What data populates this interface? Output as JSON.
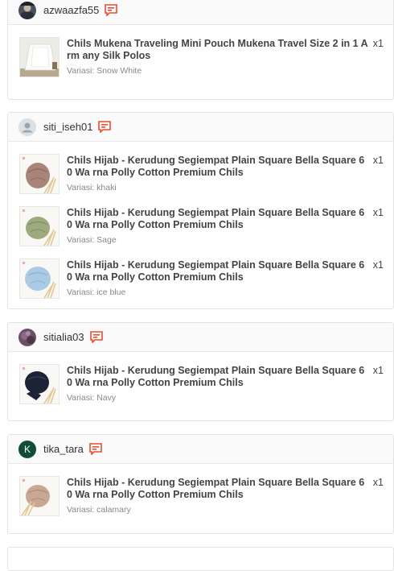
{
  "orders": [
    {
      "username": "azwaazfa55",
      "avatar": "photo-dark",
      "items": [
        {
          "title": "Chils Mukena Traveling Mini Pouch Mukena Travel Size 2 in 1 Arm any Silk Polos",
          "qty": "x1",
          "variant": "Variasi: Snow White",
          "thumb": "mukena-white"
        }
      ]
    },
    {
      "username": "siti_iseh01",
      "avatar": "default-user",
      "items": [
        {
          "title": "Chils Hijab - Kerudung Segiempat Plain Square Bella Square 60 Wa rna Polly Cotton Premium Chils",
          "qty": "x1",
          "variant": "Variasi: khaki",
          "thumb": "hijab-khaki"
        },
        {
          "title": "Chils Hijab - Kerudung Segiempat Plain Square Bella Square 60 Wa rna Polly Cotton Premium Chils",
          "qty": "x1",
          "variant": "Variasi: Sage",
          "thumb": "hijab-sage"
        },
        {
          "title": "Chils Hijab - Kerudung Segiempat Plain Square Bella Square 60 Wa rna Polly Cotton Premium Chils",
          "qty": "x1",
          "variant": "Variasi: ice blue",
          "thumb": "hijab-iceblue"
        }
      ]
    },
    {
      "username": "sitialia03",
      "avatar": "photo-purple",
      "items": [
        {
          "title": "Chils Hijab - Kerudung Segiempat Plain Square Bella Square 60 Wa rna Polly Cotton Premium Chils",
          "qty": "x1",
          "variant": "Variasi: Navy",
          "thumb": "hijab-navy"
        }
      ]
    },
    {
      "username": "tika_tara",
      "avatar": "letter",
      "avatar_letter": "K",
      "items": [
        {
          "title": "Chils Hijab - Kerudung Segiempat Plain Square Bella Square 60 Wa rna Polly Cotton Premium Chils",
          "qty": "x1",
          "variant": "Variasi: calamary",
          "thumb": "hijab-calamary"
        }
      ]
    }
  ],
  "colors": {
    "chat_icon": "#ee4d2d",
    "letter_avatar_bg": "#0f4c3a",
    "khaki": "#a98579",
    "sage": "#9caa7e",
    "iceblue": "#a9cbe6",
    "navy": "#1c2336",
    "calamary": "#c9a795"
  }
}
